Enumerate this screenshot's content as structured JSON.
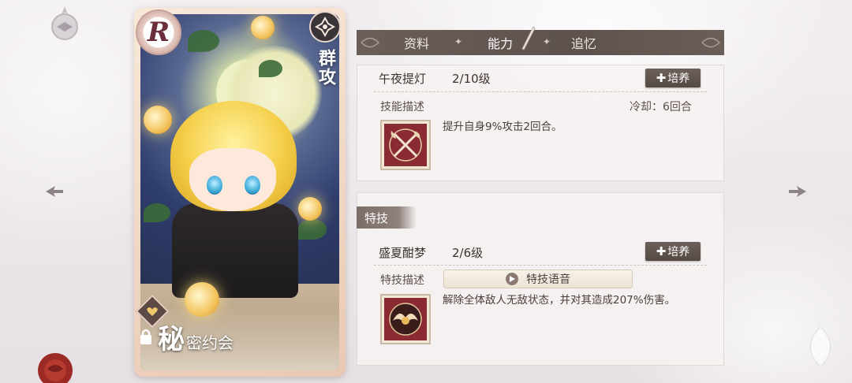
{
  "tabs": [
    {
      "label": "资料",
      "active": false
    },
    {
      "label": "能力",
      "active": true
    },
    {
      "label": "追忆",
      "active": false
    }
  ],
  "card": {
    "rarity": "R",
    "attack_type": "群攻",
    "name_big": "秘",
    "name_small": "密约会"
  },
  "skill": {
    "name": "午夜提灯",
    "level": "2/10级",
    "train_label": "培养",
    "desc_label": "技能描述",
    "cooldown": "冷却：6回合",
    "description": "提升自身9%攻击2回合。",
    "icon": "crossed-axes-icon"
  },
  "special": {
    "tag": "特技",
    "name": "盛夏酣梦",
    "level": "2/6级",
    "train_label": "培养",
    "desc_label": "特技描述",
    "voice_label": "特技语音",
    "description": "解除全体敌人无敌状态，并对其造成207%伤害。",
    "icon": "winged-emblem-icon"
  },
  "colors": {
    "tab_bar": "#5d524d",
    "button": "#554944",
    "skill_icon_bg": "#8a2a33",
    "hair": "#f5cf4a",
    "eye": "#3aa8d8"
  }
}
